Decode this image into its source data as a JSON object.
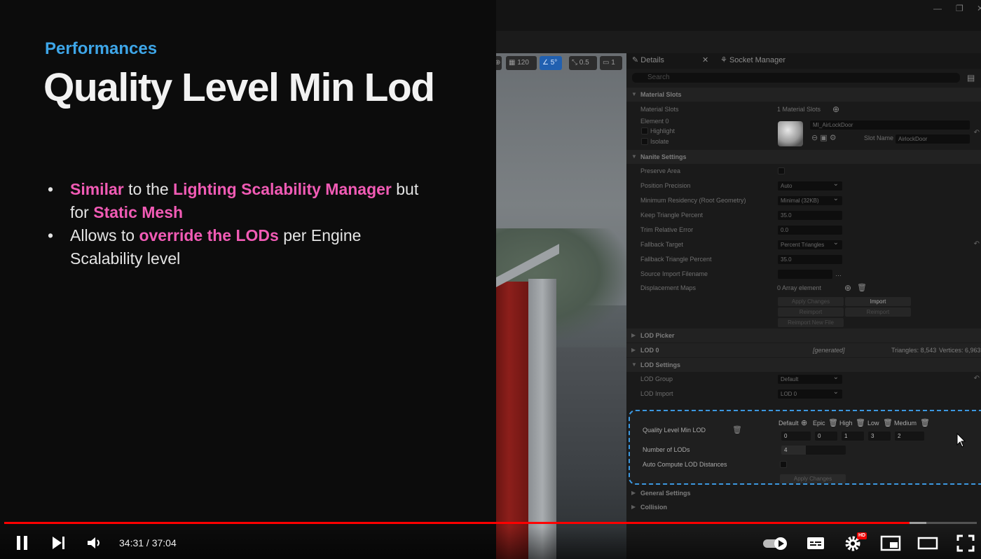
{
  "slide": {
    "section": "Performances",
    "title": "Quality Level Min Lod",
    "bullets": [
      {
        "line1": [
          {
            "text": "Similar",
            "hl": true
          },
          {
            "text": " to the ",
            "hl": false
          },
          {
            "text": "Lighting Scalability Manager",
            "hl": true
          },
          {
            "text": " but",
            "hl": false
          }
        ],
        "line2": [
          {
            "text": "for ",
            "hl": false
          },
          {
            "text": "Static Mesh",
            "hl": true
          }
        ]
      },
      {
        "line1": [
          {
            "text": "Allows to ",
            "hl": false
          },
          {
            "text": "override the LODs",
            "hl": true
          },
          {
            "text": " per Engine",
            "hl": false
          }
        ],
        "line2": [
          {
            "text": "Scalability level",
            "hl": false
          }
        ]
      }
    ],
    "highlight_color": "#f15bb5",
    "section_color": "#3ea6e8"
  },
  "viewport_toolbar": {
    "grid_value": "120",
    "angle_value": "5°",
    "scale_value": "0.5",
    "camera_speed": "1"
  },
  "details": {
    "tabs": [
      "Details",
      "Socket Manager"
    ],
    "search_placeholder": "Search",
    "material_slots": {
      "header": "Material Slots",
      "label": "Material Slots",
      "count": "1 Material Slots",
      "element": "Element 0",
      "highlight": "Highlight",
      "isolate": "Isolate",
      "material_name": "MI_AirLockDoor",
      "slot_name_label": "Slot Name",
      "slot_name": "AirlockDoor"
    },
    "nanite": {
      "header": "Nanite Settings",
      "preserve_area": "Preserve Area",
      "position_precision": "Position Precision",
      "position_precision_value": "Auto",
      "min_residency": "Minimum Residency (Root Geometry)",
      "min_residency_value": "Minimal (32KB)",
      "keep_triangle_percent": "Keep Triangle Percent",
      "keep_triangle_percent_value": "35.0",
      "trim_relative_error": "Trim Relative Error",
      "trim_relative_error_value": "0.0",
      "fallback_target": "Fallback Target",
      "fallback_target_value": "Percent Triangles",
      "fallback_triangle_percent": "Fallback Triangle Percent",
      "fallback_triangle_percent_value": "35.0",
      "source_import": "Source Import Filename",
      "displacement_maps": "Displacement Maps",
      "displacement_value": "0 Array element",
      "apply_changes": "Apply Changes",
      "import": "Import",
      "reimport": "Reimport",
      "reimport2": "Reimport",
      "reimport_new_file": "Reimport New File"
    },
    "lod_picker": "LOD Picker",
    "lod0": {
      "label": "LOD 0",
      "generated": "[generated]",
      "triangles": "Triangles: 8,543",
      "vertices": "Vertices: 6,963"
    },
    "lod_settings": {
      "header": "LOD Settings",
      "lod_group": "LOD Group",
      "lod_group_value": "Default",
      "lod_import": "LOD Import",
      "lod_import_value": "LOD 0",
      "quality_label": "Quality Level Min LOD",
      "quality_headers": [
        "Default",
        "Epic",
        "High",
        "Low",
        "Medium"
      ],
      "quality_values": [
        "0",
        "0",
        "1",
        "3",
        "2"
      ],
      "num_lods": "Number of LODs",
      "num_lods_value": "4",
      "auto_compute": "Auto Compute LOD Distances",
      "apply_changes": "Apply Changes"
    },
    "general_settings": "General Settings",
    "collision": "Collision"
  },
  "player": {
    "time": "34:31 / 37:04",
    "progress": 0.931,
    "buffered": 0.948,
    "hd_badge": "HD",
    "progress_color": "#ff0000"
  }
}
